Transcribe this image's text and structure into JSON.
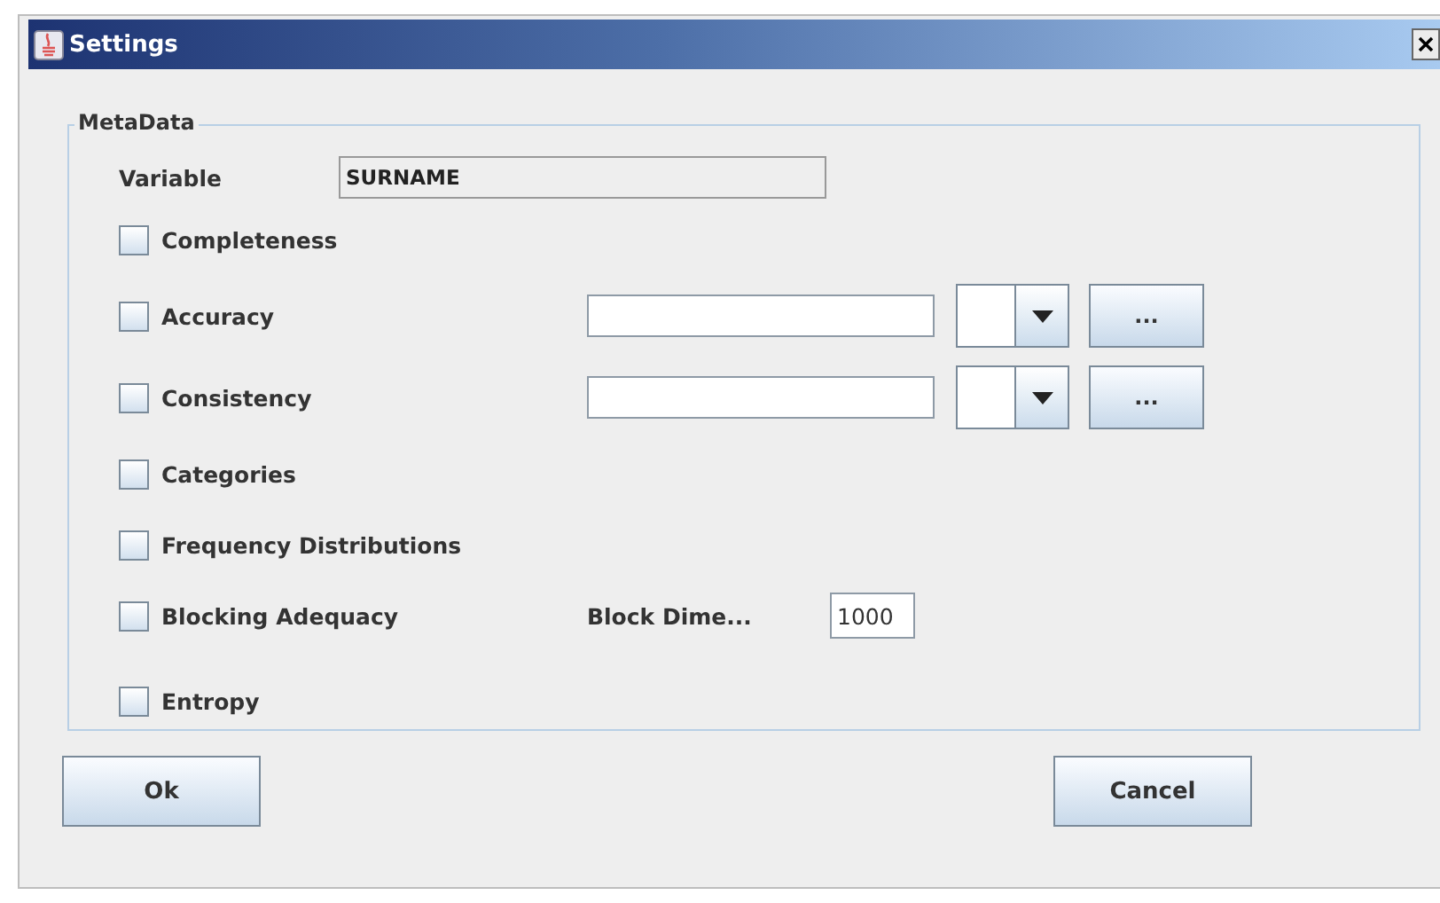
{
  "window": {
    "title": "Settings"
  },
  "group": {
    "title": "MetaData",
    "variable": {
      "label": "Variable",
      "value": "SURNAME"
    },
    "options": [
      {
        "kind": "plain",
        "label": "Completeness",
        "checked": false
      },
      {
        "kind": "rule",
        "label": "Accuracy",
        "checked": false,
        "button": "..."
      },
      {
        "kind": "rule",
        "label": "Consistency",
        "checked": false,
        "button": "..."
      },
      {
        "kind": "plain",
        "label": "Categories",
        "checked": false
      },
      {
        "kind": "plain",
        "label": "Frequency Distributions",
        "checked": false
      },
      {
        "kind": "block",
        "label": "Blocking Adequacy",
        "checked": false,
        "field_label": "Block Dime...",
        "field_value": "1000"
      },
      {
        "kind": "plain",
        "label": "Entropy",
        "checked": false
      }
    ]
  },
  "buttons": [
    {
      "label": "Ok"
    },
    {
      "label": "Cancel"
    }
  ]
}
